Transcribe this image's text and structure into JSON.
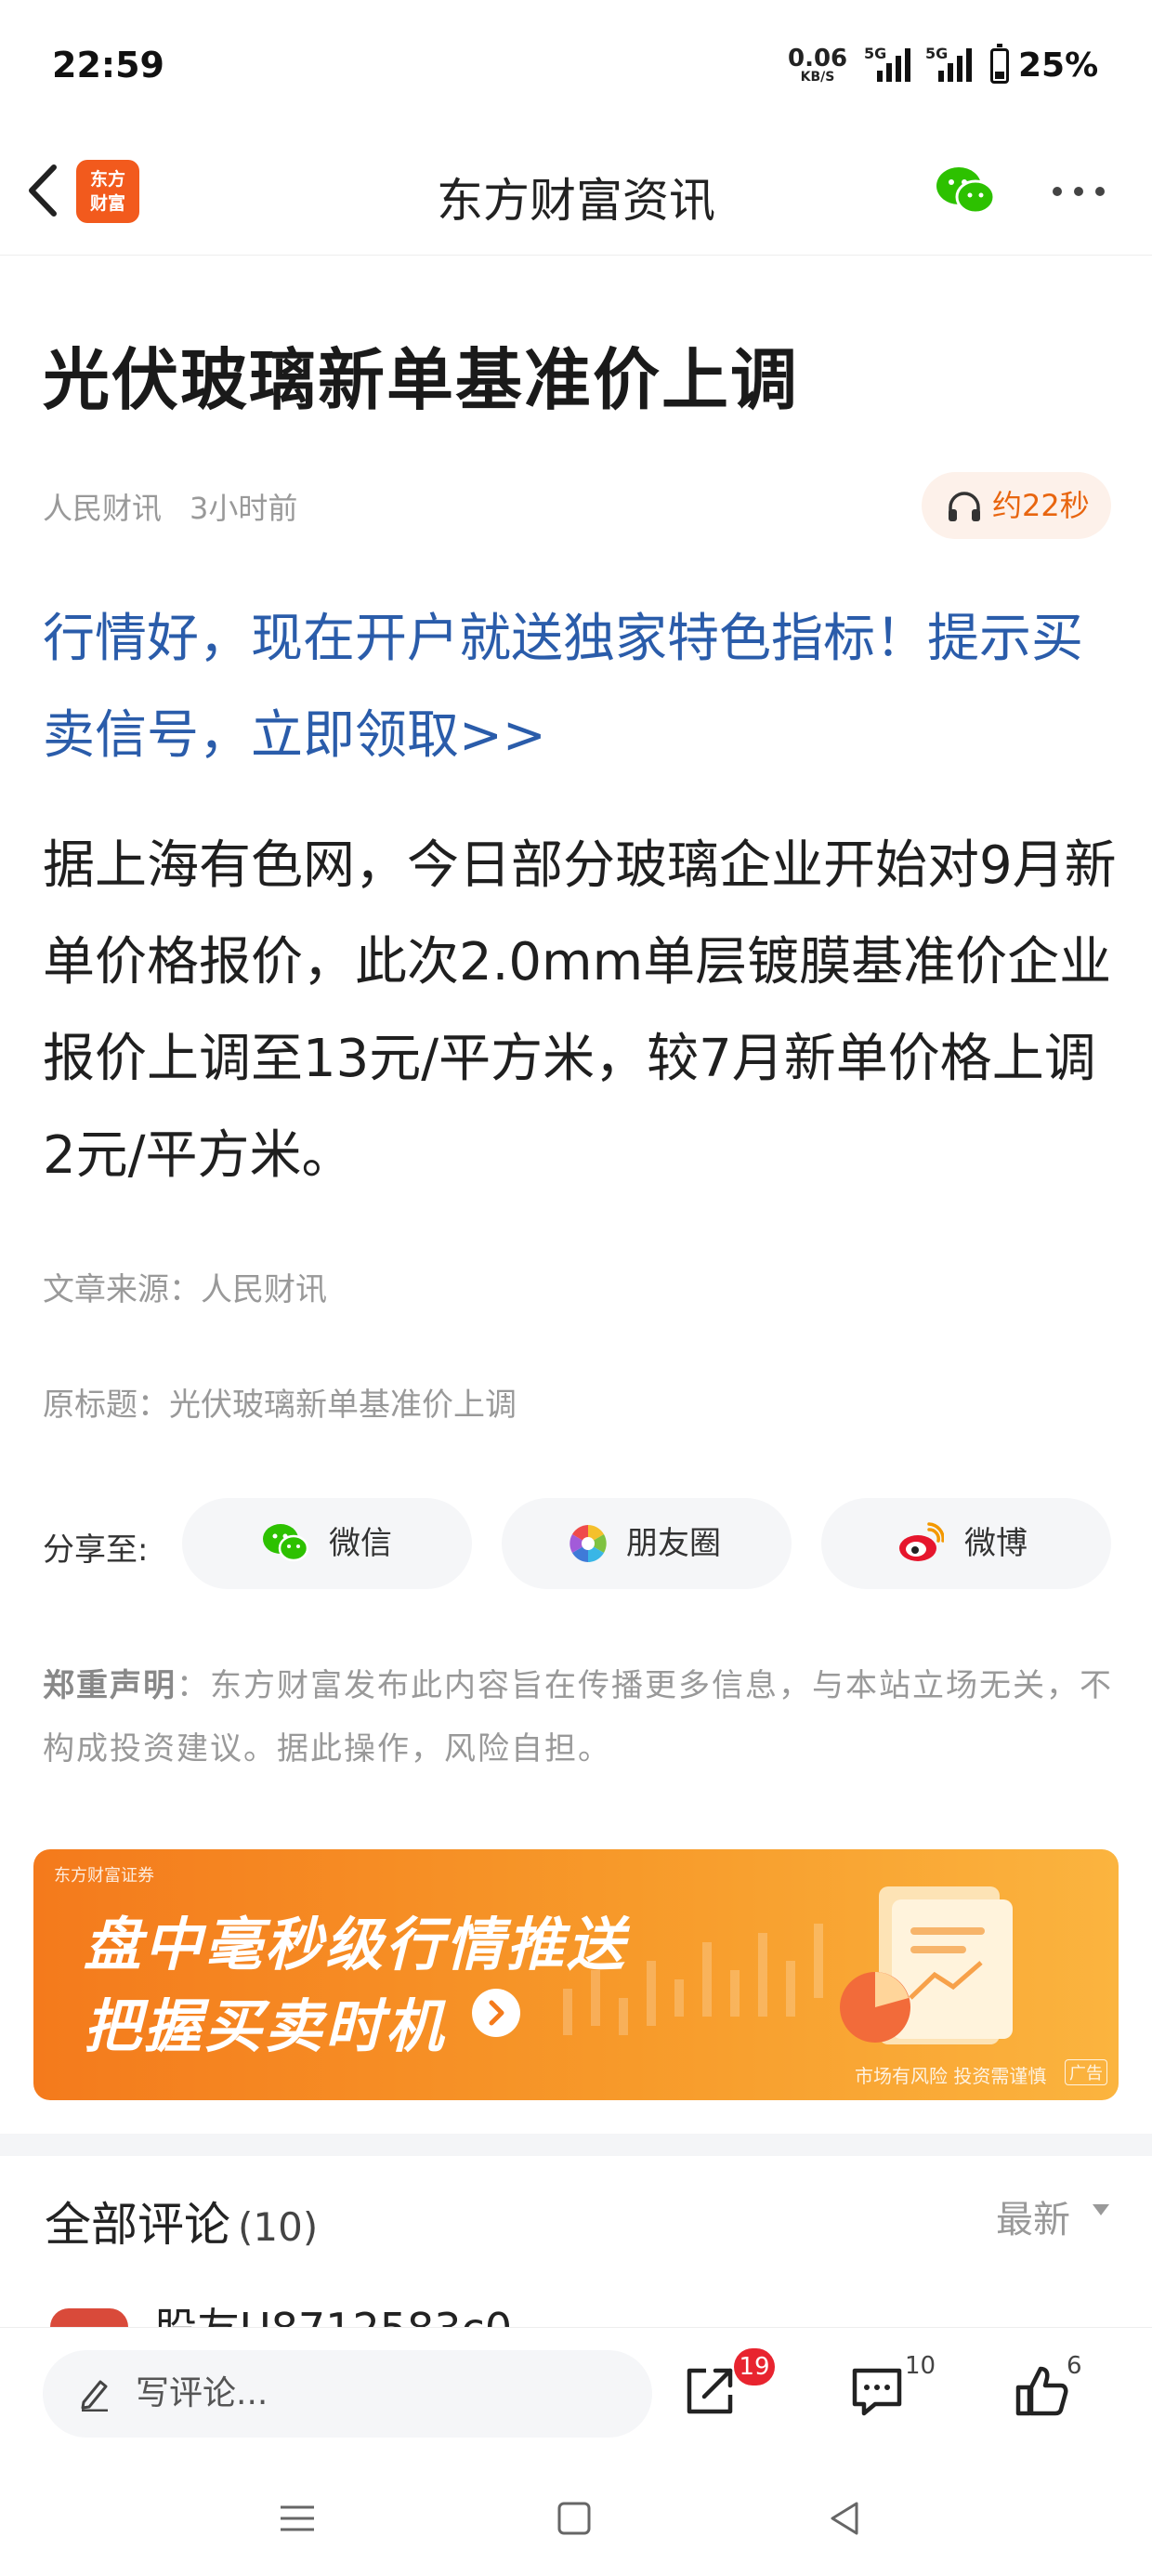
{
  "status_bar": {
    "time": "22:59",
    "net_speed": "0.06",
    "net_unit": "KB/S",
    "signal1_label": "5G",
    "signal2_label": "5G",
    "battery_percent": "25%"
  },
  "nav": {
    "logo_line1": "东方",
    "logo_line2": "财富",
    "title": "东方财富资讯"
  },
  "article": {
    "title": "光伏玻璃新单基准价上调",
    "source_name": "人民财讯",
    "time_ago": "3小时前",
    "listen_label": "约22秒",
    "promo_text": "行情好，现在开户就送独家特色指标！提示买卖信号，立即领取>>",
    "body": "据上海有色网，今日部分玻璃企业开始对9月新单价格报价，此次2.0mm单层镀膜基准价企业报价上调至13元/平方米，较7月新单价格上调2元/平方米。",
    "source_line": "文章来源：人民财讯",
    "original_title_line": "原标题：光伏玻璃新单基准价上调"
  },
  "share": {
    "label": "分享至:",
    "wechat": "微信",
    "moments": "朋友圈",
    "weibo": "微博"
  },
  "disclaimer": {
    "heading": "郑重声明",
    "text": "：东方财富发布此内容旨在传播更多信息，与本站立场无关，不构成投资建议。据此操作，风险自担。"
  },
  "ad": {
    "brand": "东方财富证券",
    "line1": "盘中毫秒级行情推送",
    "line2": "把握买卖时机",
    "risk_note": "市场有风险 投资需谨慎",
    "tag": "广告"
  },
  "comments": {
    "title": "全部评论",
    "count": "(10)",
    "sort_label": "最新",
    "first_user_partial": "股友U8712583c0"
  },
  "bottom_bar": {
    "compose_placeholder": "写评论...",
    "share_badge": "19",
    "comment_count": "10",
    "like_count": "6"
  },
  "colors": {
    "brand_orange": "#f25a1d",
    "promo_blue": "#2a5caa",
    "wechat_green": "#2dc100",
    "badge_red": "#e8242f"
  }
}
